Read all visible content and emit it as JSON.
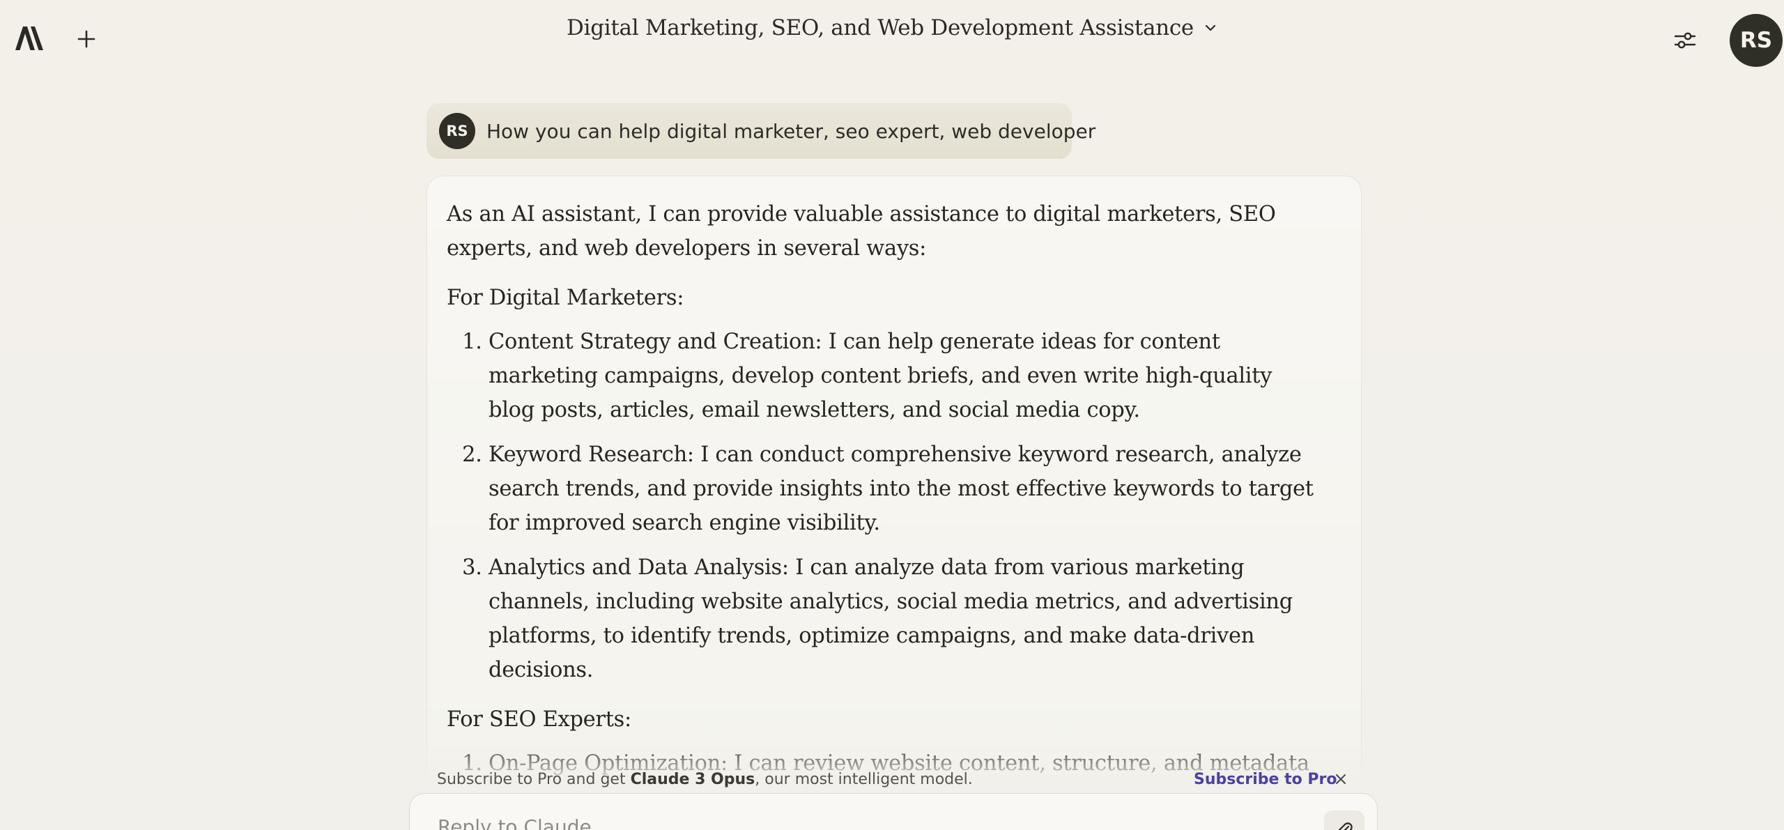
{
  "header": {
    "conversation_title": "Digital Marketing, SEO, and Web Development Assistance",
    "user_initials": "RS"
  },
  "icons": {
    "logo": "anthropic-logo-icon",
    "new_chat": "plus-icon",
    "title_menu": "chevron-down-icon",
    "settings": "sliders-icon",
    "close": "close-icon",
    "attach": "paperclip-icon"
  },
  "user_message": {
    "initials": "RS",
    "text": "How you can help digital marketer, seo expert, web developer"
  },
  "assistant_message": {
    "intro": "As an AI assistant, I can provide valuable assistance to digital marketers, SEO experts, and web developers in several ways:",
    "sections": [
      {
        "heading": "For Digital Marketers:",
        "items": [
          "Content Strategy and Creation: I can help generate ideas for content marketing campaigns, develop content briefs, and even write high-quality blog posts, articles, email newsletters, and social media copy.",
          "Keyword Research: I can conduct comprehensive keyword research, analyze search trends, and provide insights into the most effective keywords to target for improved search engine visibility.",
          "Analytics and Data Analysis: I can analyze data from various marketing channels, including website analytics, social media metrics, and advertising platforms, to identify trends, optimize campaigns, and make data-driven decisions."
        ]
      },
      {
        "heading": "For SEO Experts:",
        "items": [
          "On-Page Optimization: I can review website content, structure, and metadata to provide recommendations for improving on-page SEO factors, such as title tags, meta"
        ]
      }
    ]
  },
  "banner": {
    "text_before": "Subscribe to Pro and get ",
    "text_bold": "Claude 3 Opus",
    "text_after": ", our most intelligent model.",
    "link_label": "Subscribe to Pro"
  },
  "composer": {
    "placeholder": "Reply to Claude...",
    "value": ""
  },
  "colors": {
    "background": "#f1efe8",
    "avatar": "#2f2e27",
    "link": "#4b40a6"
  }
}
